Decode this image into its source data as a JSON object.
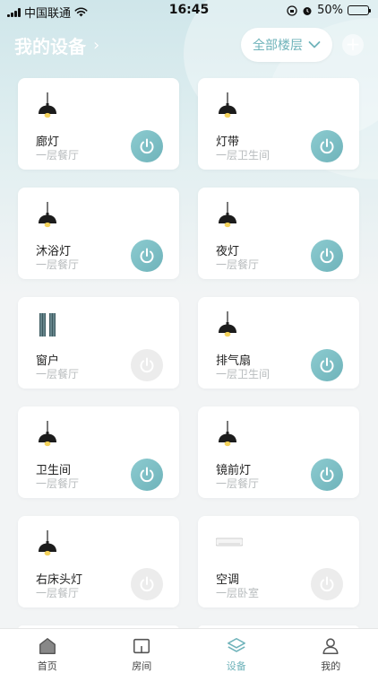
{
  "status_bar": {
    "carrier": "中国联通",
    "time": "16:45",
    "battery": "50%",
    "battery_level": 0.5
  },
  "header": {
    "title": "我的设备",
    "title_chevron": "›",
    "floor_button": "全部楼层",
    "add_button": "+"
  },
  "devices": [
    {
      "name": "廊灯",
      "room": "一层餐厅",
      "icon": "pendant-lamp-icon",
      "power": "on"
    },
    {
      "name": "灯带",
      "room": "一层卫生间",
      "icon": "pendant-lamp-icon",
      "power": "on"
    },
    {
      "name": "沐浴灯",
      "room": "一层餐厅",
      "icon": "pendant-lamp-icon",
      "power": "on"
    },
    {
      "name": "夜灯",
      "room": "一层餐厅",
      "icon": "pendant-lamp-icon",
      "power": "on"
    },
    {
      "name": "窗户",
      "room": "一层餐厅",
      "icon": "curtain-icon",
      "power": "off"
    },
    {
      "name": "排气扇",
      "room": "一层卫生间",
      "icon": "pendant-lamp-icon",
      "power": "on"
    },
    {
      "name": "卫生间",
      "room": "一层餐厅",
      "icon": "pendant-lamp-icon",
      "power": "on"
    },
    {
      "name": "镜前灯",
      "room": "一层餐厅",
      "icon": "pendant-lamp-icon",
      "power": "on"
    },
    {
      "name": "右床头灯",
      "room": "一层餐厅",
      "icon": "pendant-lamp-icon",
      "power": "off"
    },
    {
      "name": "空调",
      "room": "一层卧室",
      "icon": "air-conditioner-icon",
      "power": "off"
    }
  ],
  "tabs": [
    {
      "label": "首页",
      "icon": "home-icon",
      "active": false
    },
    {
      "label": "房间",
      "icon": "room-icon",
      "active": false
    },
    {
      "label": "设备",
      "icon": "layers-icon",
      "active": true
    },
    {
      "label": "我的",
      "icon": "user-icon",
      "active": false
    }
  ],
  "colors": {
    "accent": "#6fb3ba",
    "power_on": "#7cc0c6",
    "power_off": "#ececec",
    "muted_text": "#b8bcbe"
  }
}
